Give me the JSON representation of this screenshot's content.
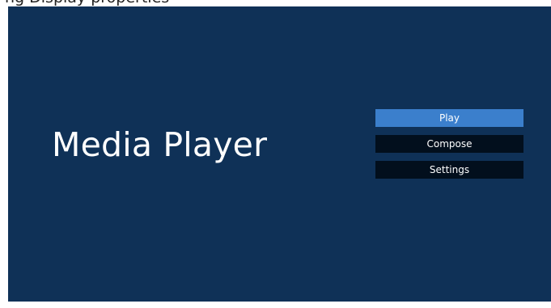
{
  "caption": "ng Display properties",
  "app": {
    "title": "Media Player"
  },
  "menu": {
    "items": [
      {
        "label": "Play",
        "selected": true
      },
      {
        "label": "Compose",
        "selected": false
      },
      {
        "label": "Settings",
        "selected": false
      }
    ]
  },
  "colors": {
    "background": "#0f3157",
    "selected_item": "#3b7fcc",
    "item": "#020f1d",
    "text": "#ffffff"
  }
}
